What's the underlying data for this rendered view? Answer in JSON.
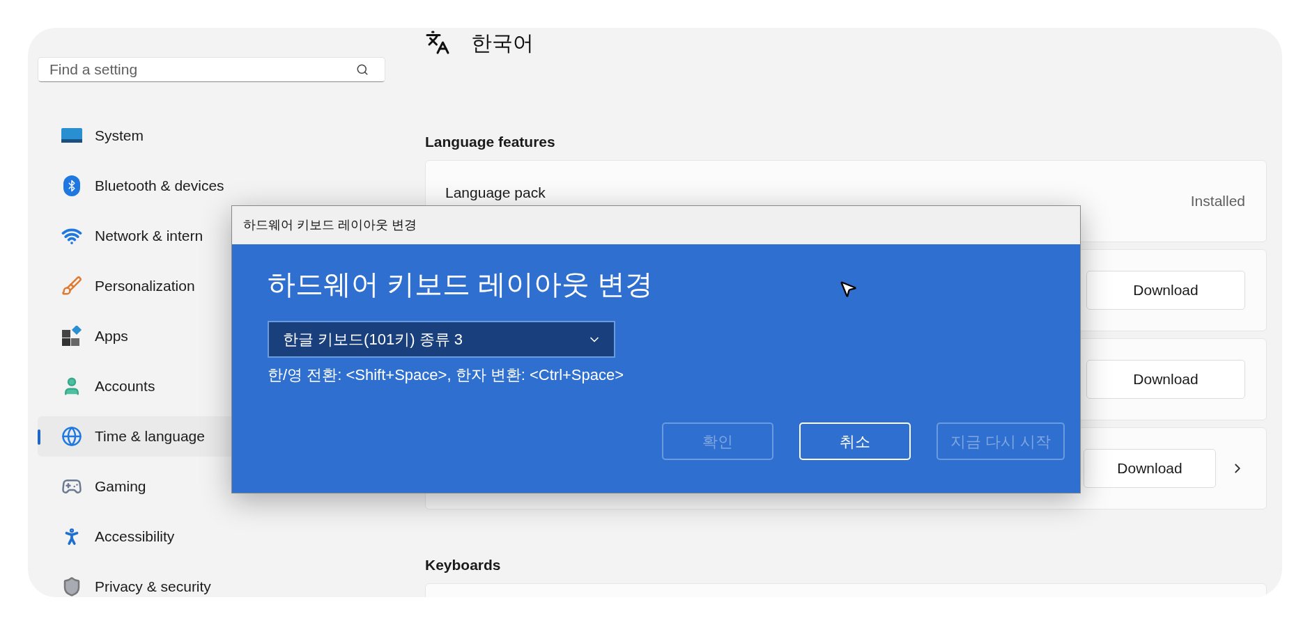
{
  "sidebar": {
    "search": {
      "placeholder": "Find a setting"
    },
    "items": [
      {
        "label": "System",
        "selected": false
      },
      {
        "label": "Bluetooth & devices",
        "selected": false
      },
      {
        "label": "Network & intern",
        "selected": false
      },
      {
        "label": "Personalization",
        "selected": false
      },
      {
        "label": "Apps",
        "selected": false
      },
      {
        "label": "Accounts",
        "selected": false
      },
      {
        "label": "Time & language",
        "selected": true
      },
      {
        "label": "Gaming",
        "selected": false
      },
      {
        "label": "Accessibility",
        "selected": false
      },
      {
        "label": "Privacy & security",
        "selected": false
      }
    ]
  },
  "main": {
    "title": "한국어",
    "sections": [
      {
        "heading": "Language features",
        "cards": [
          {
            "label": "Language pack",
            "status": "Installed"
          },
          {
            "button": "Download",
            "chevron": false
          },
          {
            "button": "Download",
            "chevron": false
          },
          {
            "button": "Download",
            "chevron": true
          }
        ]
      },
      {
        "heading": "Keyboards"
      }
    ]
  },
  "dialog": {
    "title_bar": "하드웨어 키보드 레이아웃 변경",
    "heading": "하드웨어 키보드 레이아웃 변경",
    "dropdown": {
      "value": "한글 키보드(101키) 종류 3"
    },
    "hint": "한/영 전환: <Shift+Space>, 한자 변환: <Ctrl+Space>",
    "buttons": [
      {
        "label": "확인",
        "disabled": true
      },
      {
        "label": "취소",
        "disabled": false
      },
      {
        "label": "지금 다시 시작",
        "disabled": true
      }
    ]
  }
}
